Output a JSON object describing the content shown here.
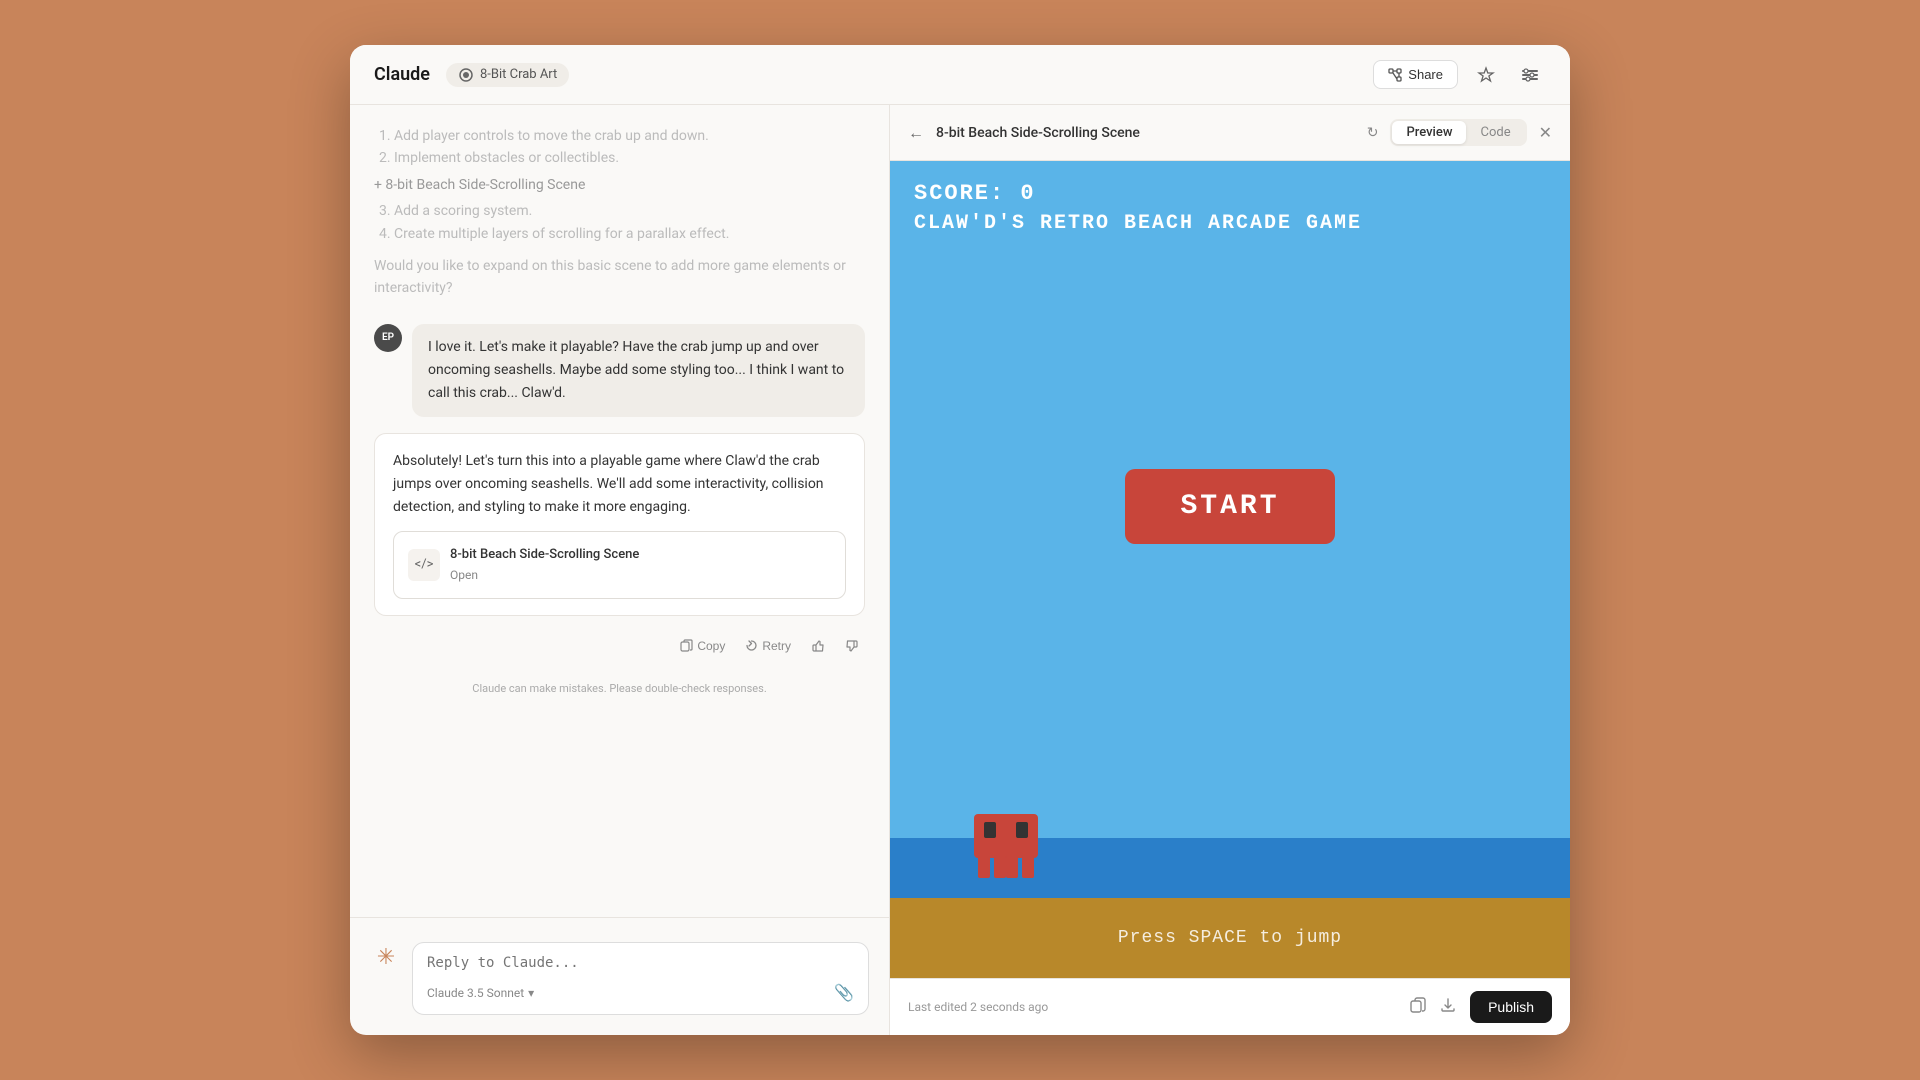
{
  "app": {
    "logo": "Claude",
    "project_name": "8-Bit Crab Art"
  },
  "header": {
    "share_label": "Share",
    "star_icon": "★",
    "settings_icon": "⚙"
  },
  "chat": {
    "faded_message": {
      "items": [
        "1. Add player controls to move the crab up and down.",
        "2. Implement obstacles or collectibles.",
        "+ 8-bit Beach Side-Scrolling Scene",
        "3. Add a scoring system.",
        "4. Create multiple layers of scrolling for a parallax effect."
      ],
      "followup": "Would you like to expand on this basic scene to add more game elements or interactivity?"
    },
    "user_message": "I love it. Let's make it playable? Have the crab jump up and over oncoming seashells. Maybe add some styling too... I think I want to call this crab... Claw'd.",
    "assistant_message": {
      "text": "Absolutely! Let's turn this into a playable game where Claw'd the crab jumps over oncoming seashells. We'll add some interactivity, collision detection, and styling to make it more engaging.",
      "artifact_title": "8-bit Beach Side-Scrolling Scene",
      "artifact_subtitle": "Open"
    },
    "actions": {
      "copy": "Copy",
      "retry": "Retry"
    },
    "disclaimer": "Claude can make mistakes. Please double-check responses.",
    "input_placeholder": "Reply to Claude...",
    "model_label": "Claude 3.5 Sonnet",
    "model_chevron": "▾"
  },
  "preview": {
    "title": "8-bit Beach Side-Scrolling Scene",
    "tab_preview": "Preview",
    "tab_code": "Code",
    "game": {
      "score_label": "SCORE: 0",
      "title_text": "CLAW'D'S RETRO BEACH ARCADE GAME",
      "start_btn": "START",
      "press_space": "Press SPACE to jump"
    },
    "footer": {
      "last_edited": "Last edited 2 seconds ago",
      "publish_label": "Publish"
    }
  }
}
